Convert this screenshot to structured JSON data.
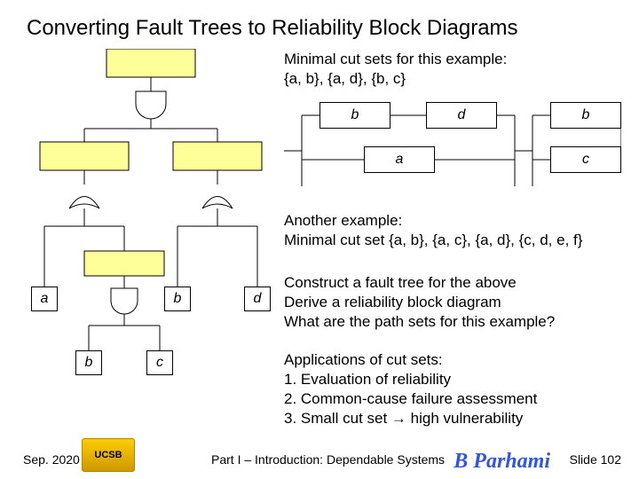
{
  "title": "Converting Fault Trees to Reliability Block Diagrams",
  "cutset_intro": "Minimal cut sets for this example:",
  "cutset_sets": "{a, b}, {a, d}, {b, c}",
  "rbd": {
    "top": [
      "b",
      "d",
      "b"
    ],
    "bottom": [
      "a",
      "c"
    ]
  },
  "tree": {
    "leaves": [
      "a",
      "b",
      "d",
      "b",
      "c"
    ]
  },
  "another": {
    "l1": "Another example:",
    "l2": "Minimal cut set {a, b}, {a, c}, {a, d}, {c, d, e, f}"
  },
  "construct": {
    "l1": "Construct a fault tree for the above",
    "l2": "Derive a reliability block diagram",
    "l3": "What are the path sets for this example?"
  },
  "apps": {
    "l1": "Applications of cut sets:",
    "l2": "1. Evaluation of reliability",
    "l3": "2. Common-cause failure assessment",
    "l4": "3. Small cut set → high vulnerability"
  },
  "footer": {
    "date": "Sep. 2020",
    "mid": "Part I – Introduction: Dependable Systems",
    "slide": "Slide 102",
    "logo": "UCSB",
    "author": "B Parhami"
  }
}
